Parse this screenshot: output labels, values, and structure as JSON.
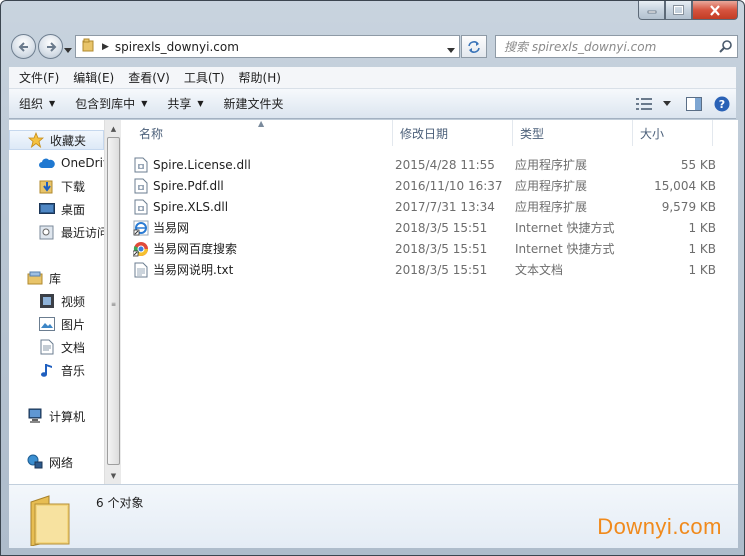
{
  "window": {
    "caption_buttons": [
      "minimize",
      "maximize",
      "close"
    ]
  },
  "address": {
    "crumb": "spirexls_downyi.com",
    "search_placeholder": "搜索 spirexls_downyi.com"
  },
  "menu": [
    "文件(F)",
    "编辑(E)",
    "查看(V)",
    "工具(T)",
    "帮助(H)"
  ],
  "commands": {
    "organize": "组织",
    "include_library": "包含到库中",
    "share": "共享",
    "new_folder": "新建文件夹"
  },
  "nav": {
    "favorites": "收藏夹",
    "onedrive": "OneDrive",
    "downloads": "下载",
    "desktop": "桌面",
    "recent": "最近访问",
    "libraries": "库",
    "videos": "视频",
    "pictures": "图片",
    "documents": "文档",
    "music": "音乐",
    "computer": "计算机",
    "network": "网络"
  },
  "columns": {
    "name": "名称",
    "modified": "修改日期",
    "type": "类型",
    "size": "大小"
  },
  "files": [
    {
      "name": "Spire.License.dll",
      "date": "2015/4/28 11:55",
      "type": "应用程序扩展",
      "size": "55 KB",
      "icon": "dll-icon"
    },
    {
      "name": "Spire.Pdf.dll",
      "date": "2016/11/10 16:37",
      "type": "应用程序扩展",
      "size": "15,004 KB",
      "icon": "dll-icon"
    },
    {
      "name": "Spire.XLS.dll",
      "date": "2017/7/31 13:34",
      "type": "应用程序扩展",
      "size": "9,579 KB",
      "icon": "dll-icon"
    },
    {
      "name": "当易网",
      "date": "2018/3/5 15:51",
      "type": "Internet 快捷方式",
      "size": "1 KB",
      "icon": "ie-shortcut-icon"
    },
    {
      "name": "当易网百度搜索",
      "date": "2018/3/5 15:51",
      "type": "Internet 快捷方式",
      "size": "1 KB",
      "icon": "chrome-shortcut-icon"
    },
    {
      "name": "当易网说明.txt",
      "date": "2018/3/5 15:51",
      "type": "文本文档",
      "size": "1 KB",
      "icon": "text-file-icon"
    }
  ],
  "status": {
    "count": "6 个对象"
  },
  "watermark": "Downyi.com",
  "colors": {
    "accent": "#f08a1c",
    "header_text": "#4c607a",
    "close_button": "#c23c25"
  }
}
